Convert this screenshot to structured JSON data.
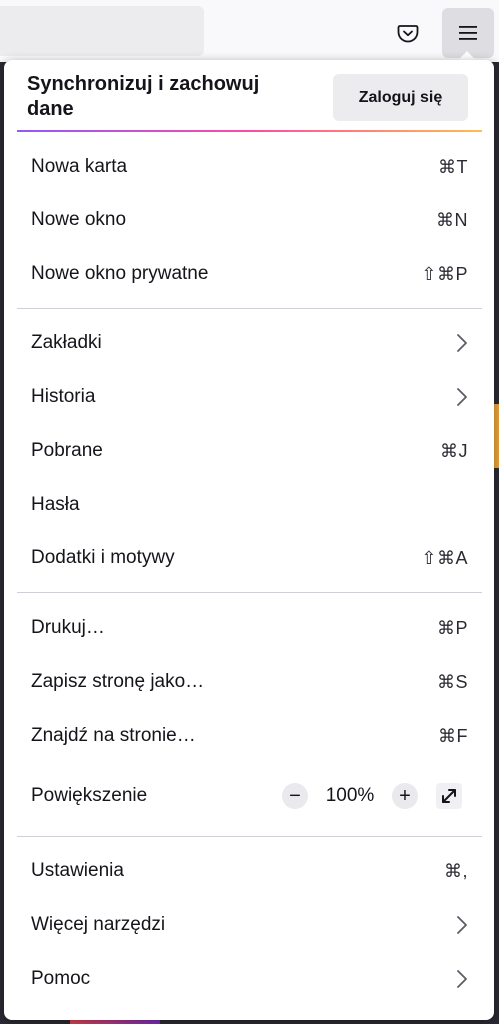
{
  "toolbar": {
    "pocket_icon": "pocket-icon",
    "menu_icon": "hamburger-menu-icon"
  },
  "sync": {
    "title": "Synchronizuj i zachowuj dane",
    "signin_label": "Zaloguj się"
  },
  "menu": {
    "new_tab": {
      "label": "Nowa karta",
      "shortcut": "⌘T"
    },
    "new_window": {
      "label": "Nowe okno",
      "shortcut": "⌘N"
    },
    "new_private_window": {
      "label": "Nowe okno prywatne",
      "shortcut": "⇧⌘P"
    },
    "bookmarks": {
      "label": "Zakładki"
    },
    "history": {
      "label": "Historia"
    },
    "downloads": {
      "label": "Pobrane",
      "shortcut": "⌘J"
    },
    "passwords": {
      "label": "Hasła"
    },
    "addons": {
      "label": "Dodatki i motywy",
      "shortcut": "⇧⌘A"
    },
    "print": {
      "label": "Drukuj…",
      "shortcut": "⌘P"
    },
    "save_as": {
      "label": "Zapisz stronę jako…",
      "shortcut": "⌘S"
    },
    "find": {
      "label": "Znajdź na stronie…",
      "shortcut": "⌘F"
    },
    "zoom": {
      "label": "Powiększenie",
      "minus": "−",
      "value": "100%",
      "plus": "+"
    },
    "settings": {
      "label": "Ustawienia",
      "shortcut": "⌘,"
    },
    "more_tools": {
      "label": "Więcej narzędzi"
    },
    "help": {
      "label": "Pomoc"
    }
  },
  "colors": {
    "panel_bg": "#ffffff",
    "separator": "#cfcfd8",
    "text": "#15141a",
    "sync_gradient": [
      "#9059ff",
      "#ff4aa2",
      "#ffbd4f"
    ]
  }
}
